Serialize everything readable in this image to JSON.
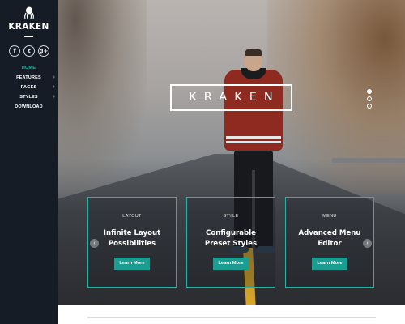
{
  "sidebar": {
    "brand": "KRAKEN",
    "logo_icon": "octopus-icon",
    "socials": [
      {
        "icon": "facebook-icon",
        "glyph": "f"
      },
      {
        "icon": "twitter-icon",
        "glyph": "t"
      },
      {
        "icon": "google-plus-icon",
        "glyph": "g+"
      }
    ],
    "nav": [
      {
        "label": "HOME",
        "active": true,
        "has_submenu": false
      },
      {
        "label": "FEATURES",
        "active": false,
        "has_submenu": true
      },
      {
        "label": "PAGES",
        "active": false,
        "has_submenu": true
      },
      {
        "label": "STYLES",
        "active": false,
        "has_submenu": true
      },
      {
        "label": "DOWNLOAD",
        "active": false,
        "has_submenu": false
      }
    ]
  },
  "hero": {
    "title": "KRAKEN",
    "slides": 3,
    "active_slide": 1,
    "prev_icon": "chevron-left-icon",
    "next_icon": "chevron-right-icon"
  },
  "cards": [
    {
      "category": "LAYOUT",
      "title": "Infinite Layout Possibilities",
      "button": "Learn More"
    },
    {
      "category": "STYLE",
      "title": "Configurable Preset Styles",
      "button": "Learn More"
    },
    {
      "category": "MENU",
      "title": "Advanced Menu Editor",
      "button": "Learn More"
    }
  ],
  "colors": {
    "sidebar_bg": "#161c26",
    "accent": "#1fb5a8",
    "button": "#1a9c90"
  }
}
